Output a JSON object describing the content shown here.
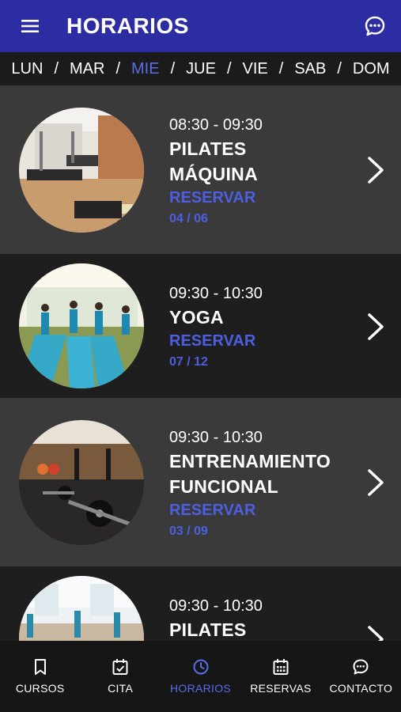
{
  "header": {
    "title": "HORARIOS",
    "menu_icon": "hamburger-icon",
    "chat_icon": "chat-bubble-icon"
  },
  "days": [
    {
      "label": "LUN",
      "active": false
    },
    {
      "label": "MAR",
      "active": false
    },
    {
      "label": "MIE",
      "active": true
    },
    {
      "label": "JUE",
      "active": false
    },
    {
      "label": "VIE",
      "active": false
    },
    {
      "label": "SAB",
      "active": false
    },
    {
      "label": "DOM",
      "active": false
    }
  ],
  "day_separator": "/",
  "classes": [
    {
      "time": "08:30 - 09:30",
      "name_line1": "PILATES",
      "name_line2": "MÁQUINA",
      "reserve": "RESERVAR",
      "count": "04 / 06"
    },
    {
      "time": "09:30 - 10:30",
      "name_line1": "YOGA",
      "name_line2": "",
      "reserve": "RESERVAR",
      "count": "07 / 12"
    },
    {
      "time": "09:30 - 10:30",
      "name_line1": "ENTRENAMIENTO",
      "name_line2": "FUNCIONAL",
      "reserve": "RESERVAR",
      "count": "03 / 09"
    },
    {
      "time": "09:30 - 10:30",
      "name_line1": "PILATES",
      "name_line2": "",
      "reserve": "",
      "count": ""
    }
  ],
  "tabs": [
    {
      "label": "CURSOS",
      "icon": "bookmark-icon",
      "active": false
    },
    {
      "label": "CITA",
      "icon": "calendar-check-icon",
      "active": false
    },
    {
      "label": "HORARIOS",
      "icon": "clock-icon",
      "active": true
    },
    {
      "label": "RESERVAS",
      "icon": "calendar-grid-icon",
      "active": false
    },
    {
      "label": "CONTACTO",
      "icon": "chat-bubble-icon",
      "active": false
    }
  ],
  "colors": {
    "primary": "#2c2ca3",
    "accent": "#4d5fe0",
    "card_gray": "#3a3a3a",
    "card_dark": "#1e1e1e"
  }
}
